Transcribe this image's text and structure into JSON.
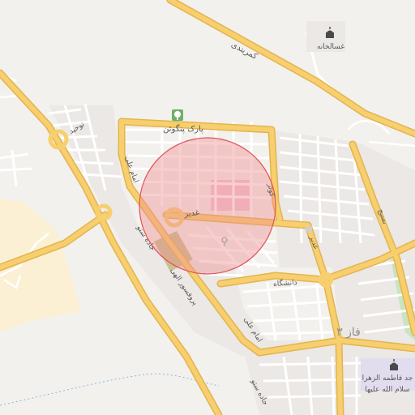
{
  "map": {
    "colors": {
      "land": "#f3f1ee",
      "residential": "#ebe8e6",
      "road_major": "#f7cf6e",
      "road_major_casing": "#e3b44f",
      "road_minor": "#ffffff",
      "road_minor_casing": "#d8d3cf",
      "sand": "#fbf0d4",
      "park": "#c8e4c0",
      "pink_area": "#f3c6d8",
      "olive_area": "#c9c28f",
      "lavender_area": "#e2dcef",
      "water_line": "#8bb8d8",
      "highlight_fill": "#ef8d8f",
      "highlight_stroke": "#e0545b",
      "icon_dark": "#4a4a4a"
    },
    "labels": {
      "kamarbandi": "کمربندی",
      "ghasalkhane": "غسالخانه",
      "park_pangoan": "پارک پنگوئن",
      "ghadir_left": "غدیر",
      "ghadir_right": "غدیر",
      "imam_ali_top": "امام علی",
      "imam_ali_bottom": "امام علی",
      "jadde_sonto_top": "جاده ستو",
      "jadde_sonto_bottom": "جاده ستو",
      "prof_hesabi": "پروفسور الهی",
      "daneshgah": "دانشگاه",
      "basij": "بسیج",
      "faz3": "فاز ۳",
      "tohid": "توحید",
      "koosar": "کوثر",
      "fatemeh_line1": "جد فاطمه الزهرا",
      "fatemeh_line2": "سلام الله علیها"
    },
    "icons": {
      "mosque_top": "mosque-icon",
      "tree": "tree-icon",
      "mosque_bottom": "mosque-icon",
      "pin": "pin-icon"
    }
  }
}
